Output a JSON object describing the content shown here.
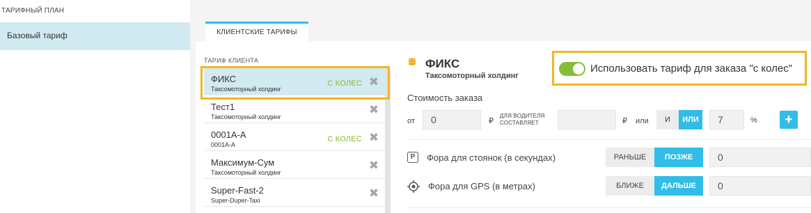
{
  "sidebar": {
    "title": "ТАРИФНЫЙ ПЛАН",
    "items": [
      {
        "label": "Базовый тариф"
      }
    ]
  },
  "tabs": [
    {
      "label": "КЛИЕНТСКИЕ ТАРИФЫ"
    }
  ],
  "tariff_list": {
    "title": "ТАРИФ КЛИЕНТА",
    "rows": [
      {
        "name": "ФИКС",
        "sub": "Таксомоторный холдинг",
        "badge": "С КОЛЕС",
        "selected": true
      },
      {
        "name": "Тест1",
        "sub": "Таксомоторный холдинг",
        "badge": ""
      },
      {
        "name": "0001А-А",
        "sub": "0001А-А",
        "badge": "С КОЛЕС"
      },
      {
        "name": "Максимум-Сум",
        "sub": "Таксомоторный холдинг",
        "badge": ""
      },
      {
        "name": "Super-Fast-2",
        "sub": "Super-Duper-Taxi",
        "badge": ""
      }
    ]
  },
  "detail": {
    "title": "ФИКС",
    "subtitle": "Таксомоторный холдинг",
    "toggle_label": "Использовать тариф для заказа \"с колес\"",
    "toggle_on": true,
    "cost_label": "Стоимость заказа",
    "from_label": "от",
    "from_value": "0",
    "currency": "₽",
    "driver_label": "ДЛЯ ВОДИТЕЛЯ СОСТАВЛЯЕТ",
    "driver_value": "",
    "currency2": "₽",
    "or_label": "или",
    "and_btn": "И",
    "or_btn": "ИЛИ",
    "percent_value": "7",
    "percent_sign": "%",
    "plus": "+",
    "parking_label": "Фора для стоянок (в секундах)",
    "parking_earlier": "РАНЬШЕ",
    "parking_later": "ПОЗЖЕ",
    "parking_value": "0",
    "gps_label": "Фора для GPS (в метрах)",
    "gps_closer": "БЛИЖЕ",
    "gps_further": "ДАЛЬШЕ",
    "gps_value": "0"
  },
  "colors": {
    "accent": "#30bde8",
    "badge": "#86bb2a",
    "highlight": "#f3b61f",
    "toggle": "#84be3a"
  }
}
